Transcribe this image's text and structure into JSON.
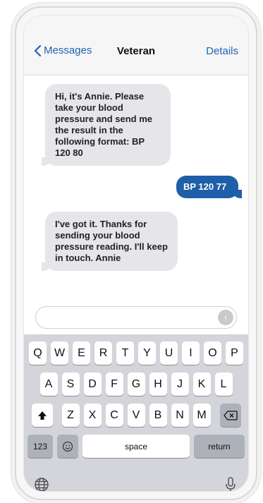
{
  "nav": {
    "back_label": "Messages",
    "title": "Veteran",
    "details_label": "Details"
  },
  "messages": [
    {
      "direction": "incoming",
      "text": "Hi, it's Annie. Please take your blood pressure and send me the result in the following format: BP 120 80"
    },
    {
      "direction": "outgoing",
      "text": "BP 120 77"
    },
    {
      "direction": "incoming",
      "text": "I've got it. Thanks for sending your blood pressure reading. I'll keep in touch. Annie"
    }
  ],
  "input": {
    "value": "",
    "placeholder": ""
  },
  "keyboard": {
    "row1": [
      "Q",
      "W",
      "E",
      "R",
      "T",
      "Y",
      "U",
      "I",
      "O",
      "P"
    ],
    "row2": [
      "A",
      "S",
      "D",
      "F",
      "G",
      "H",
      "J",
      "K",
      "L"
    ],
    "row3": [
      "Z",
      "X",
      "C",
      "V",
      "B",
      "N",
      "M"
    ],
    "numbers_label": "123",
    "space_label": "space",
    "return_label": "return"
  },
  "icons": {
    "back": "chevron-left-icon",
    "send": "arrow-up-icon",
    "shift": "shift-icon",
    "delete": "delete-icon",
    "emoji": "emoji-icon",
    "globe": "globe-icon",
    "mic": "microphone-icon"
  },
  "colors": {
    "accent": "#1f63b5",
    "outgoing_bubble": "#1f5ea8",
    "incoming_bubble": "#e6e6ea"
  }
}
